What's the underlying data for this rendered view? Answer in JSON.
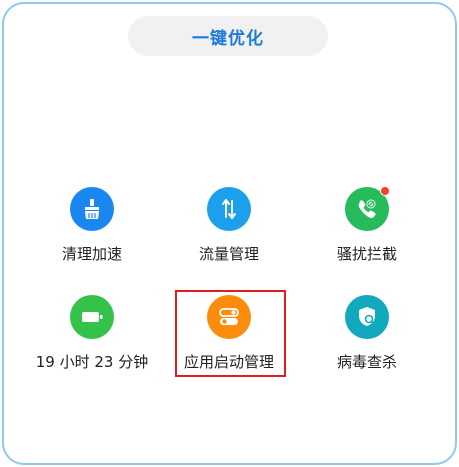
{
  "header": {
    "optimize_label": "一键优化"
  },
  "tiles": [
    {
      "label": "清理加速",
      "icon": "broom-icon",
      "color": "#1a87f0"
    },
    {
      "label": "流量管理",
      "icon": "data-arrows-icon",
      "color": "#1da0ec"
    },
    {
      "label": "骚扰拦截",
      "icon": "phone-block-icon",
      "color": "#27bb5c"
    },
    {
      "label": "19 小时 23 分钟",
      "icon": "battery-icon",
      "color": "#34c24a"
    },
    {
      "label": "应用启动管理",
      "icon": "toggle-icon",
      "color": "#fb8c0c"
    },
    {
      "label": "病毒查杀",
      "icon": "shield-scan-icon",
      "color": "#12a9bf"
    }
  ],
  "colors": {
    "highlight": "#e01e1e",
    "accent": "#1d7ad8"
  }
}
